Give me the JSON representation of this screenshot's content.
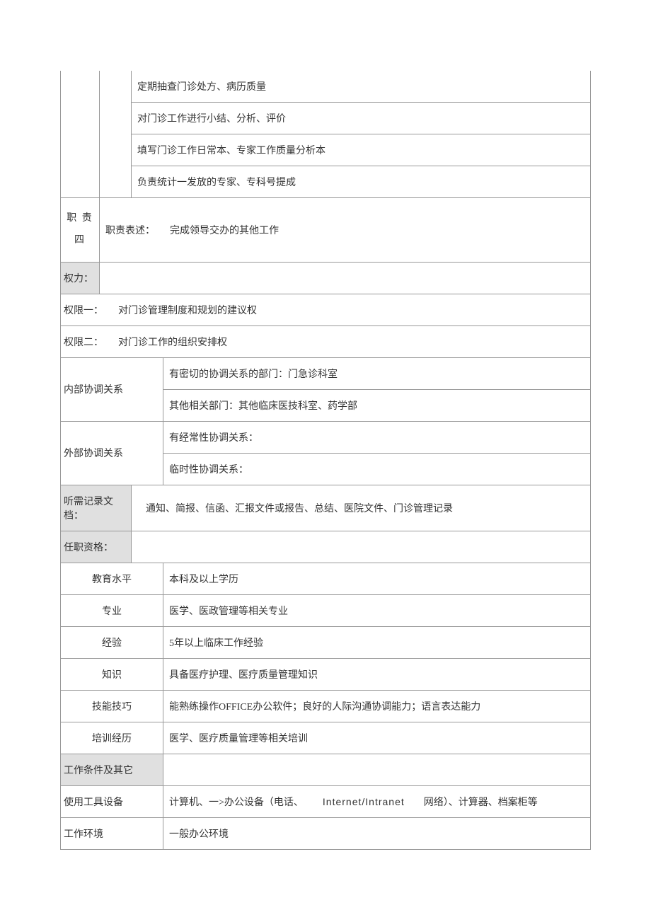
{
  "duties": {
    "tasks": [
      "定期抽查门诊处方、病历质量",
      "对门诊工作进行小结、分析、评价",
      "填写门诊工作日常本、专家工作质量分析本",
      "负责统计一发放的专家、专科号提成"
    ],
    "four": {
      "label": "职 责 四",
      "desc_label": "职责表述：",
      "desc_value": "完成领导交办的其他工作"
    }
  },
  "rights": {
    "header": "权力：",
    "r1_label": "权限一：",
    "r1_value": "对门诊管理制度和规划的建议权",
    "r2_label": "权限二：",
    "r2_value": "对门诊工作的组织安排权"
  },
  "coord": {
    "internal_label": "内部协调关系",
    "internal_1": "有密切的协调关系的部门：门急诊科室",
    "internal_2": "其他相关部门：其他临床医技科室、药学部",
    "external_label": "外部协调关系",
    "external_1": "有经常性协调关系：",
    "external_2": "临时性协调关系："
  },
  "docs": {
    "label": "听需记录文档：",
    "value": "通知、简报、信函、汇报文件或报告、总结、医院文件、门诊管理记录"
  },
  "qual": {
    "header": "任职资格：",
    "rows": [
      {
        "label": "教育水平",
        "value": "本科及以上学历"
      },
      {
        "label": "专业",
        "value": "医学、医政管理等相关专业"
      },
      {
        "label": "经验",
        "value": "5年以上临床工作经验"
      },
      {
        "label": "知识",
        "value": "具备医疗护理、医疗质量管理知识"
      },
      {
        "label": "技能技巧",
        "value": "能熟练操作OFFICE办公软件；良好的人际沟通协调能力；语言表达能力"
      },
      {
        "label": "培训经历",
        "value": "医学、医疗质量管理等相关培训"
      }
    ]
  },
  "work": {
    "header": "工作条件及其它",
    "tools_label": "使用工具设备",
    "tools_value_1": "计算机、一>办公设备（电话、",
    "tools_value_2": "Internet/Intranet",
    "tools_value_3": "网络）、计算器、档案柜等",
    "env_label": "工作环境",
    "env_value": "一般办公环境"
  }
}
